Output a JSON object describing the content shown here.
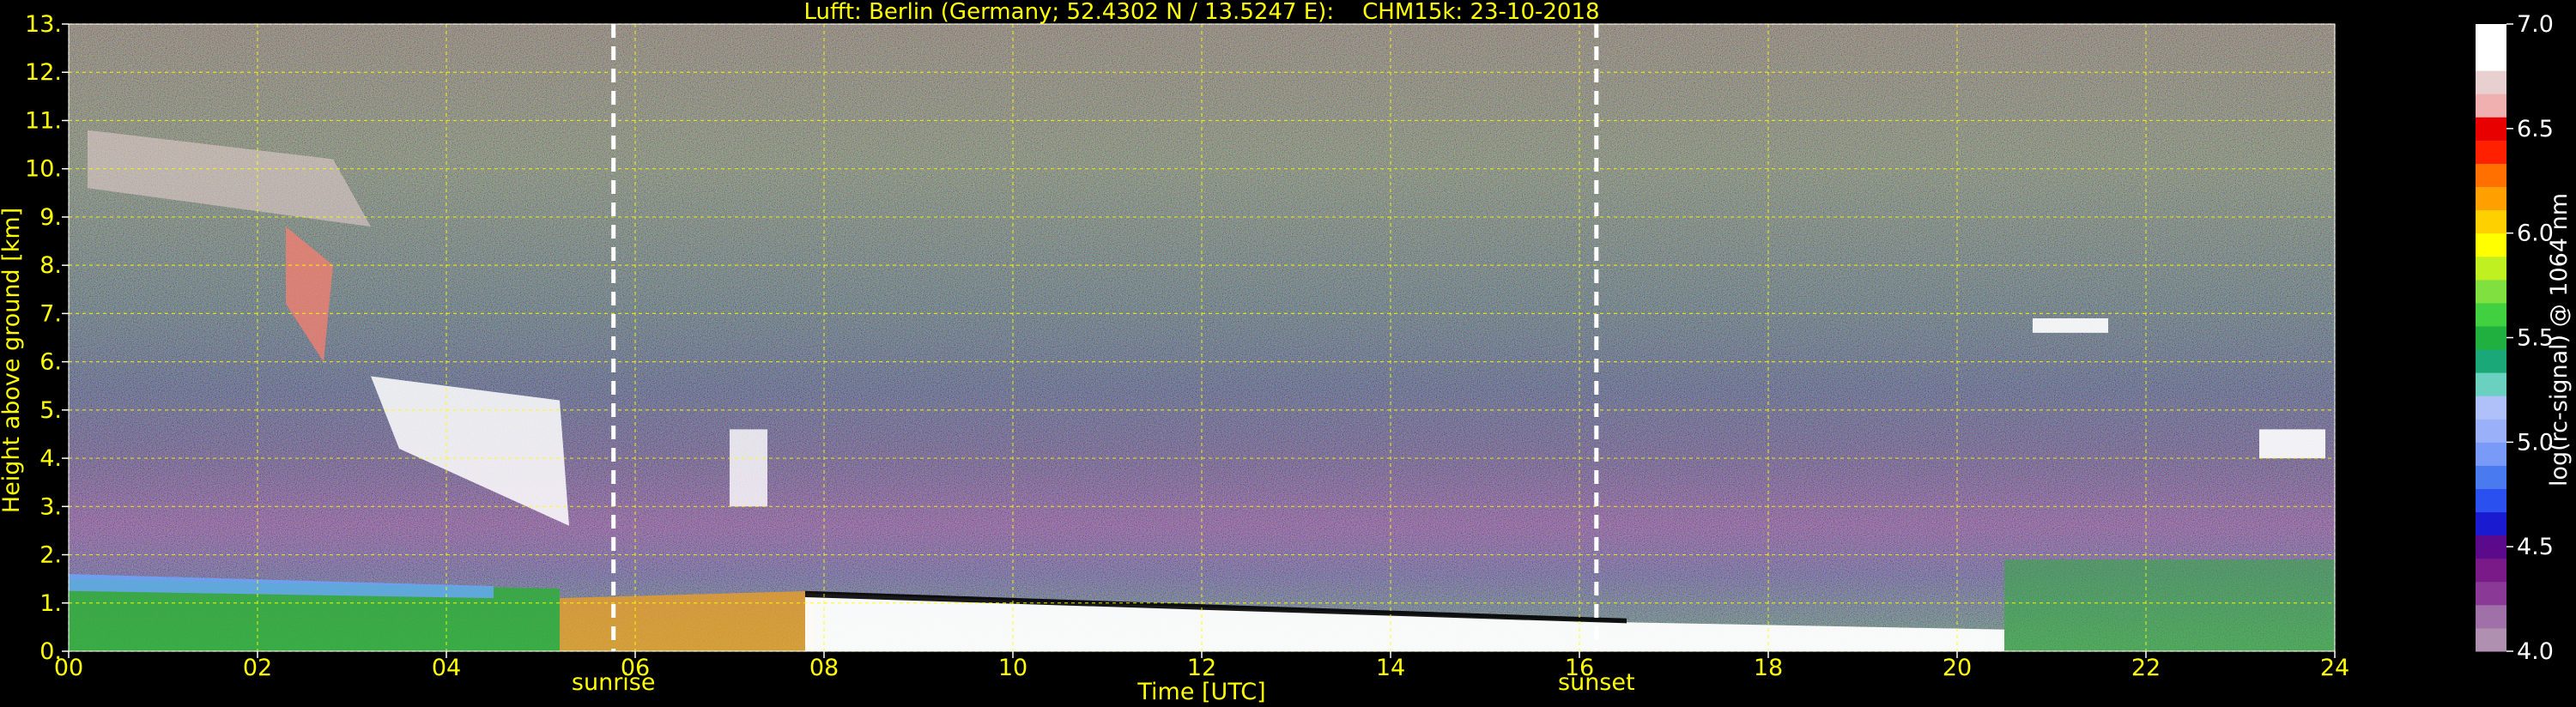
{
  "chart_data": {
    "type": "heatmap",
    "title": "Lufft: Berlin (Germany; 52.4302 N / 13.5247 E):    CHM15k: 23-10-2018",
    "xlabel": "Time [UTC]",
    "ylabel": "Height above ground [km]",
    "xlim": [
      0,
      24
    ],
    "ylim": [
      0,
      13
    ],
    "x_ticks": [
      0,
      2,
      4,
      6,
      8,
      10,
      12,
      14,
      16,
      18,
      20,
      22,
      24
    ],
    "x_tick_labels": [
      "00",
      "02",
      "04",
      "06",
      "08",
      "10",
      "12",
      "14",
      "16",
      "18",
      "20",
      "22",
      "24"
    ],
    "y_ticks": [
      0,
      1,
      2,
      3,
      4,
      5,
      6,
      7,
      8,
      9,
      10,
      11,
      12,
      13
    ],
    "y_tick_labels": [
      "0.",
      "1.",
      "2.",
      "3.",
      "4.",
      "5.",
      "6.",
      "7.",
      "8.",
      "9.",
      "10.",
      "11.",
      "12.",
      "13."
    ],
    "grid": true,
    "markers": [
      {
        "label": "sunrise",
        "time": 5.77
      },
      {
        "label": "sunset",
        "time": 16.18
      }
    ],
    "colorbar": {
      "label": "log(rc-signal) @ 1064 nm",
      "range": [
        4.0,
        7.0
      ],
      "ticks": [
        4.0,
        4.5,
        5.0,
        5.5,
        6.0,
        6.5,
        7.0
      ],
      "tick_labels": [
        "4.0",
        "4.5",
        "5.0",
        "5.5",
        "6.0",
        "6.5",
        "7.0"
      ]
    }
  }
}
